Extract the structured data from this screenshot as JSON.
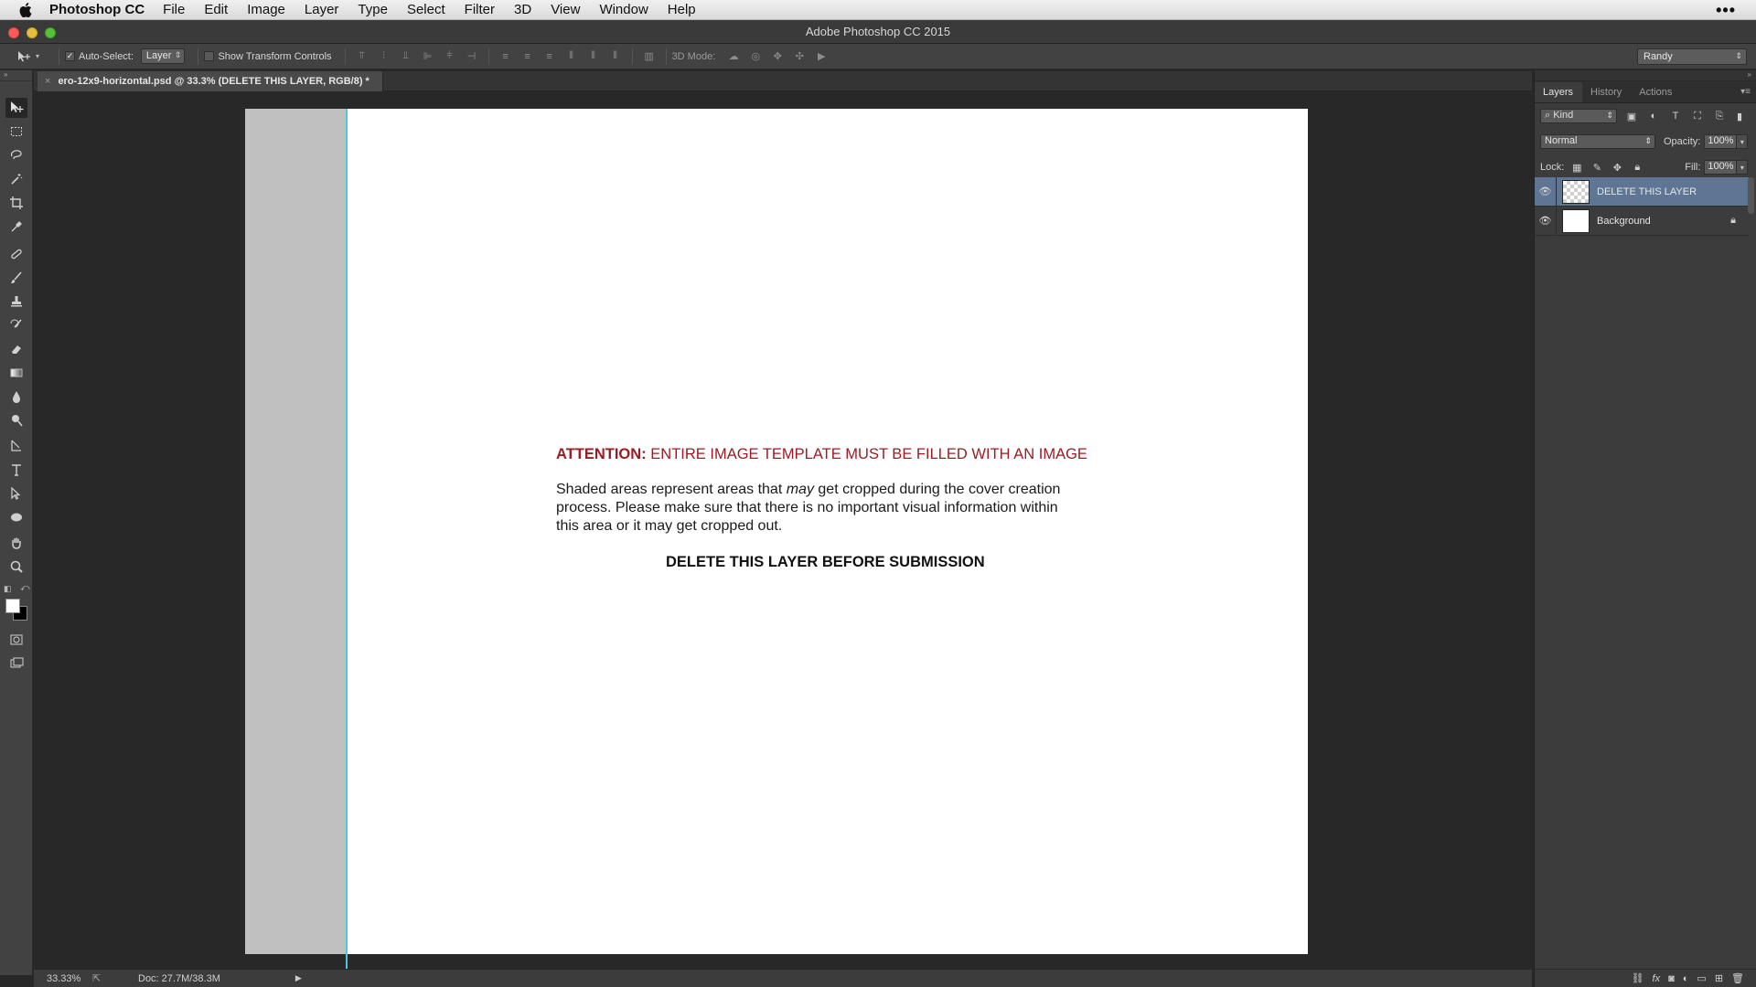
{
  "menubar": {
    "app_name": "Photoshop CC",
    "items": [
      "File",
      "Edit",
      "Image",
      "Layer",
      "Type",
      "Select",
      "Filter",
      "3D",
      "View",
      "Window",
      "Help"
    ],
    "more": "•••"
  },
  "window": {
    "title": "Adobe Photoshop CC 2015"
  },
  "options": {
    "auto_select_label": "Auto-Select:",
    "auto_select_value": "Layer",
    "transform_label": "Show Transform Controls",
    "mode_label": "3D Mode:",
    "workspace": "Randy"
  },
  "document": {
    "tab_title": "ero-12x9-horizontal.psd @ 33.3% (DELETE THIS LAYER, RGB/8) *",
    "attention_bold": "ATTENTION:",
    "attention_text": " ENTIRE IMAGE TEMPLATE MUST BE FILLED WITH AN IMAGE",
    "notice_pre": "Shaded areas represent areas that ",
    "notice_em": "may",
    "notice_post": " get cropped during the cover creation process. Please make sure that there is no important visual information within this area or it may get cropped out.",
    "delete_note": "DELETE THIS LAYER BEFORE SUBMISSION"
  },
  "status": {
    "zoom": "33.33%",
    "doc_size": "Doc: 27.7M/38.3M"
  },
  "panel": {
    "tabs": [
      "Layers",
      "History",
      "Actions"
    ],
    "filter_kind": "Kind",
    "blend_mode": "Normal",
    "opacity_label": "Opacity:",
    "opacity_value": "100%",
    "lock_label": "Lock:",
    "fill_label": "Fill:",
    "fill_value": "100%",
    "layers": [
      {
        "name": "DELETE THIS LAYER",
        "selected": true,
        "locked": false
      },
      {
        "name": "Background",
        "selected": false,
        "locked": true
      }
    ]
  },
  "colors": {
    "accent_guide": "#4fc6e0",
    "attention_red": "#9b1c24",
    "layer_selected": "#5e7694",
    "foreground": "#ffffff",
    "background": "#000000"
  }
}
